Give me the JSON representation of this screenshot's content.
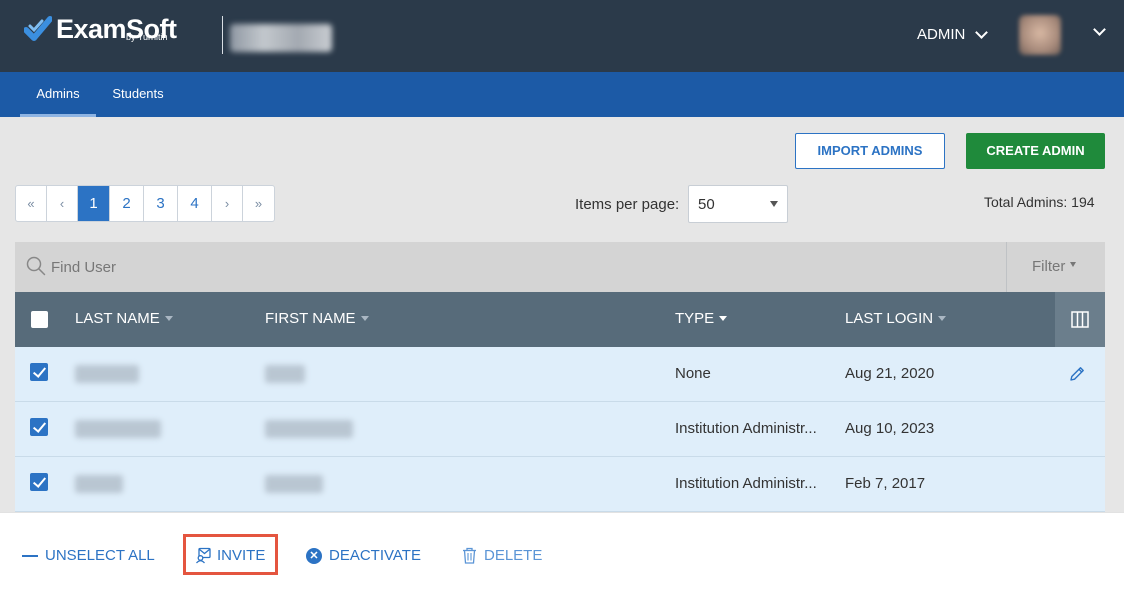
{
  "header": {
    "brand": "ExamSoft",
    "brand_sub": "by Turnitin",
    "admin_menu_label": "ADMIN"
  },
  "tabs": [
    {
      "label": "Admins",
      "active": true
    },
    {
      "label": "Students",
      "active": false
    }
  ],
  "actions": {
    "import_label": "IMPORT ADMINS",
    "create_label": "CREATE ADMIN"
  },
  "pagination": {
    "first": "«",
    "prev": "‹",
    "pages": [
      "1",
      "2",
      "3",
      "4"
    ],
    "current_page": "1",
    "next": "›",
    "last": "»"
  },
  "items_per_page": {
    "label": "Items per page:",
    "value": "50"
  },
  "total": "Total Admins: 194",
  "search": {
    "placeholder": "Find User",
    "filter_label": "Filter"
  },
  "table": {
    "columns": [
      "LAST NAME",
      "FIRST NAME",
      "TYPE",
      "LAST LOGIN"
    ],
    "rows": [
      {
        "type": "None",
        "last_login": "Aug 21, 2020",
        "selected": true
      },
      {
        "type": "Institution Administr...",
        "last_login": "Aug 10, 2023",
        "selected": true
      },
      {
        "type": "Institution Administr...",
        "last_login": "Feb 7, 2017",
        "selected": true
      }
    ]
  },
  "bulk_actions": {
    "unselect_all": "UNSELECT ALL",
    "invite": "INVITE",
    "deactivate": "DEACTIVATE",
    "delete": "DELETE"
  },
  "colors": {
    "header_bg": "#2b3a4a",
    "tab_bar": "#1c5aa6",
    "primary": "#2c73c4",
    "create_green": "#1f8a3b",
    "highlight_red": "#e4553f"
  }
}
